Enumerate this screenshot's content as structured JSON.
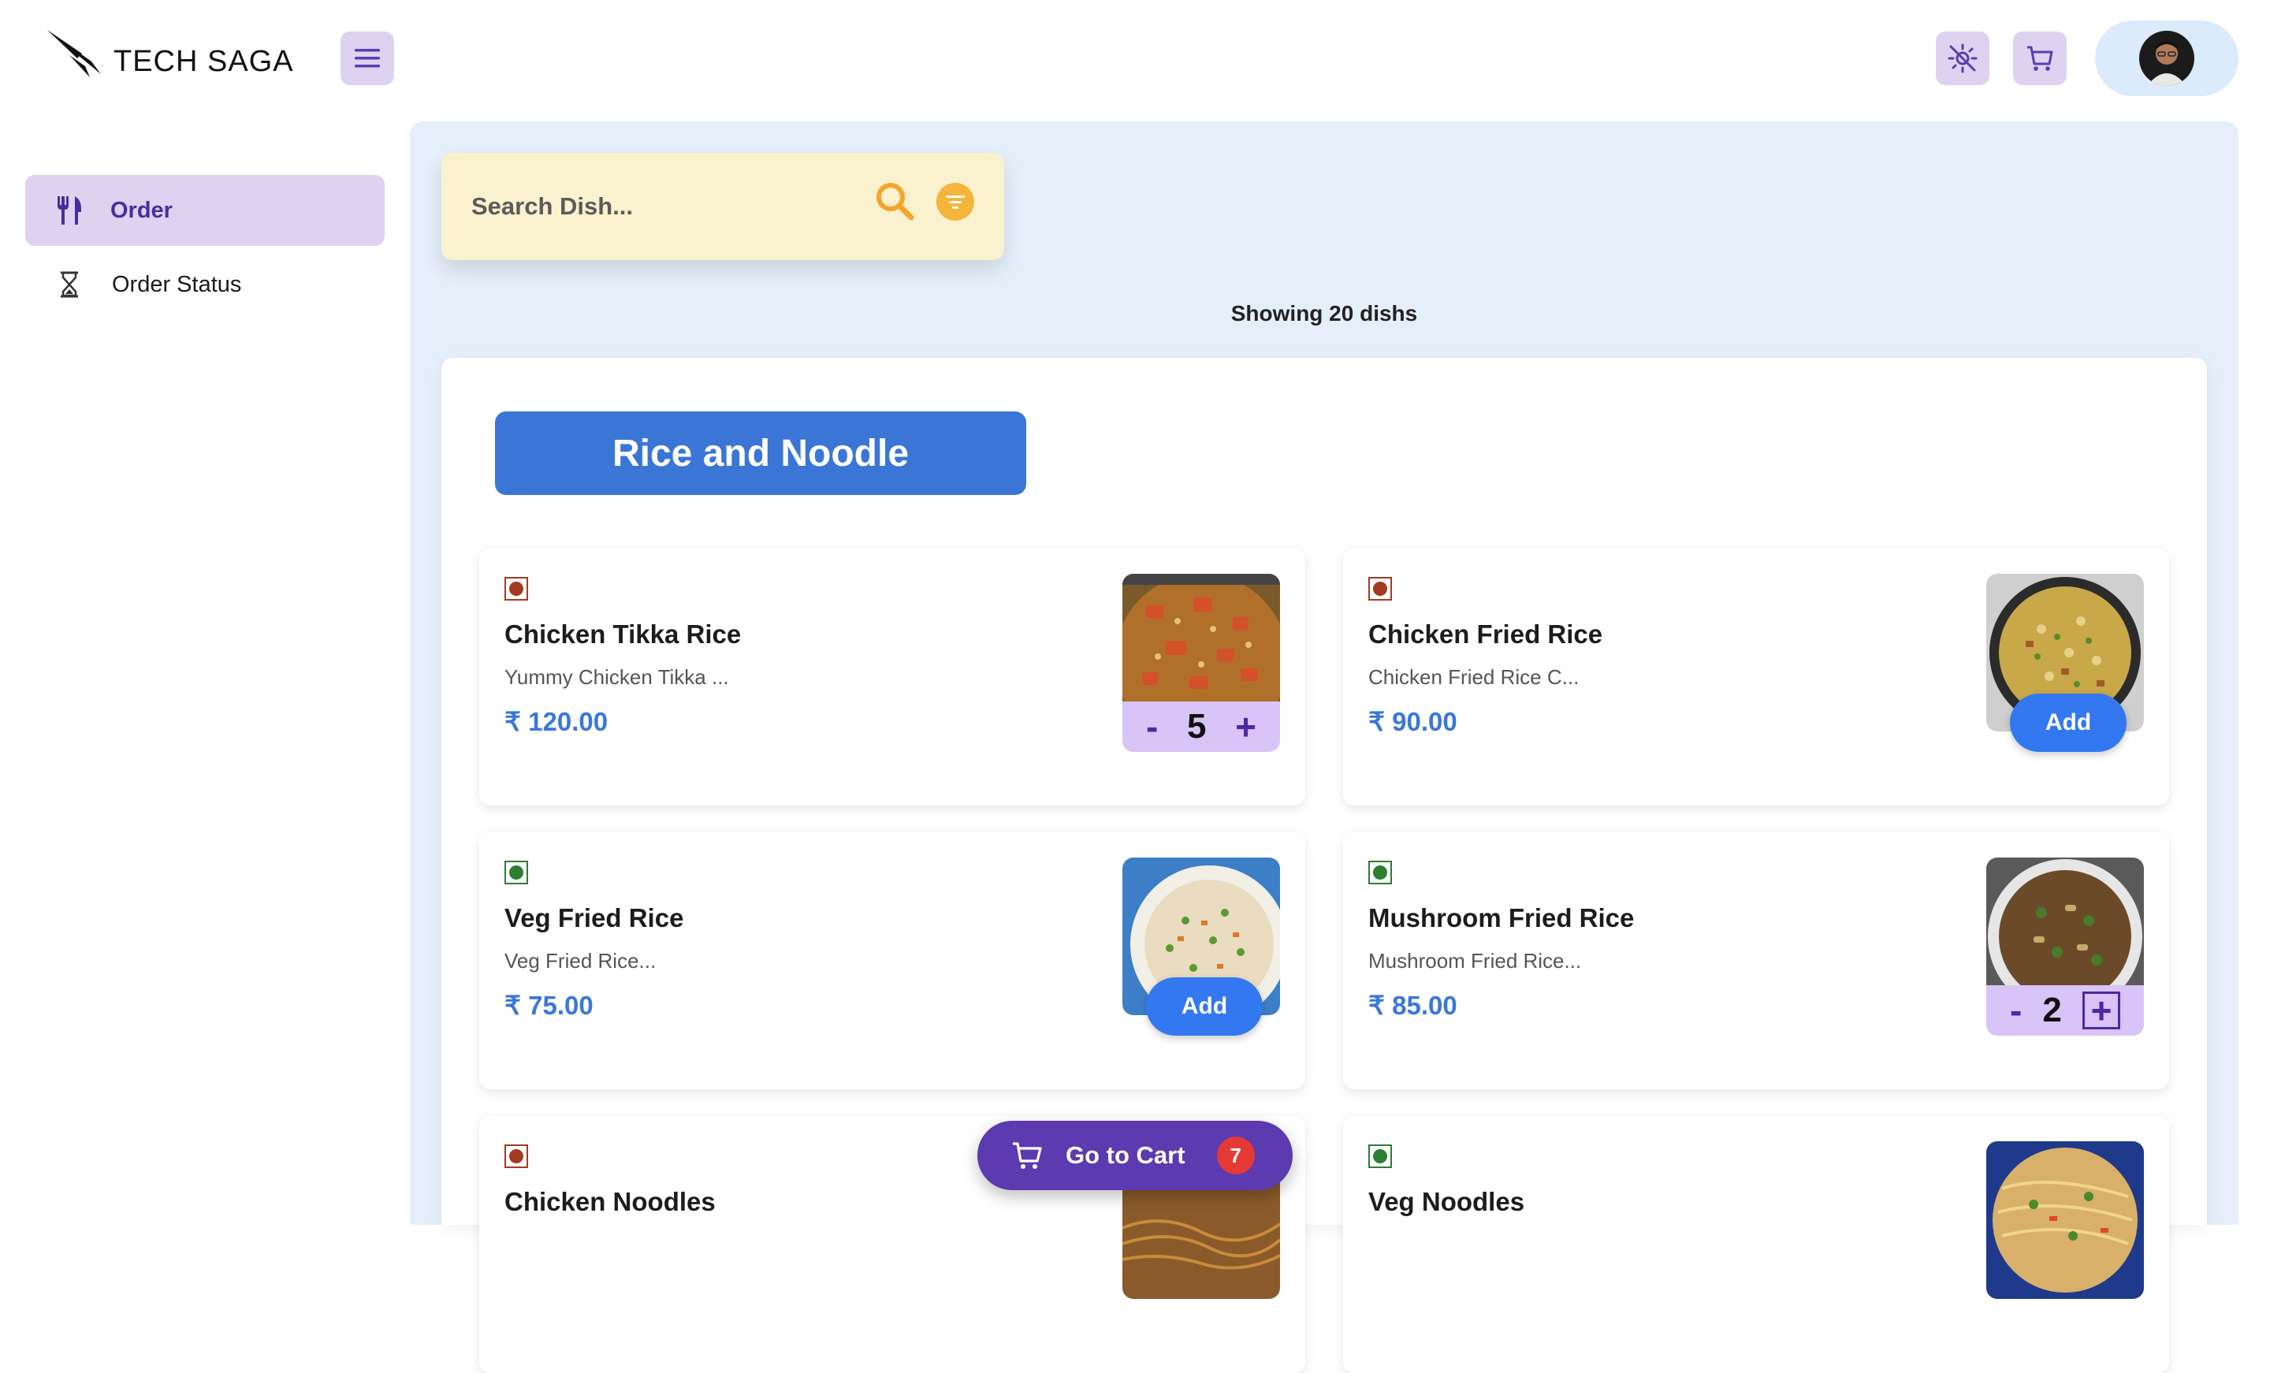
{
  "header": {
    "brand": "TECH SAGA"
  },
  "sidebar": {
    "items": [
      {
        "label": "Order",
        "active": true
      },
      {
        "label": "Order Status",
        "active": false
      }
    ]
  },
  "search": {
    "placeholder": "Search Dish..."
  },
  "summary": {
    "showing": "Showing 20 dishs"
  },
  "category": {
    "title": "Rice and Noodle"
  },
  "dishes": [
    {
      "name": "Chicken Tikka Rice",
      "desc": "Yummy Chicken Tikka ...",
      "price": "₹ 120.00",
      "type": "nonveg",
      "qty": "5",
      "action": "stepper"
    },
    {
      "name": "Chicken Fried Rice",
      "desc": "Chicken Fried Rice C...",
      "price": "₹ 90.00",
      "type": "nonveg",
      "action": "add",
      "add_label": "Add"
    },
    {
      "name": "Veg Fried Rice",
      "desc": "Veg Fried Rice...",
      "price": "₹ 75.00",
      "type": "veg",
      "action": "add",
      "add_label": "Add"
    },
    {
      "name": "Mushroom Fried Rice",
      "desc": "Mushroom Fried Rice...",
      "price": "₹ 85.00",
      "type": "veg",
      "qty": "2",
      "action": "stepper"
    },
    {
      "name": "Chicken Noodles",
      "type": "nonveg"
    },
    {
      "name": "Veg Noodles",
      "type": "veg"
    }
  ],
  "stepper": {
    "minus": "-",
    "plus": "+"
  },
  "cart": {
    "label": "Go to Cart",
    "count": "7"
  },
  "colors": {
    "accent": "#5c3aaf",
    "category": "#3b76d6",
    "price": "#3a78d8",
    "add": "#3378f0",
    "badge": "#e53935"
  }
}
